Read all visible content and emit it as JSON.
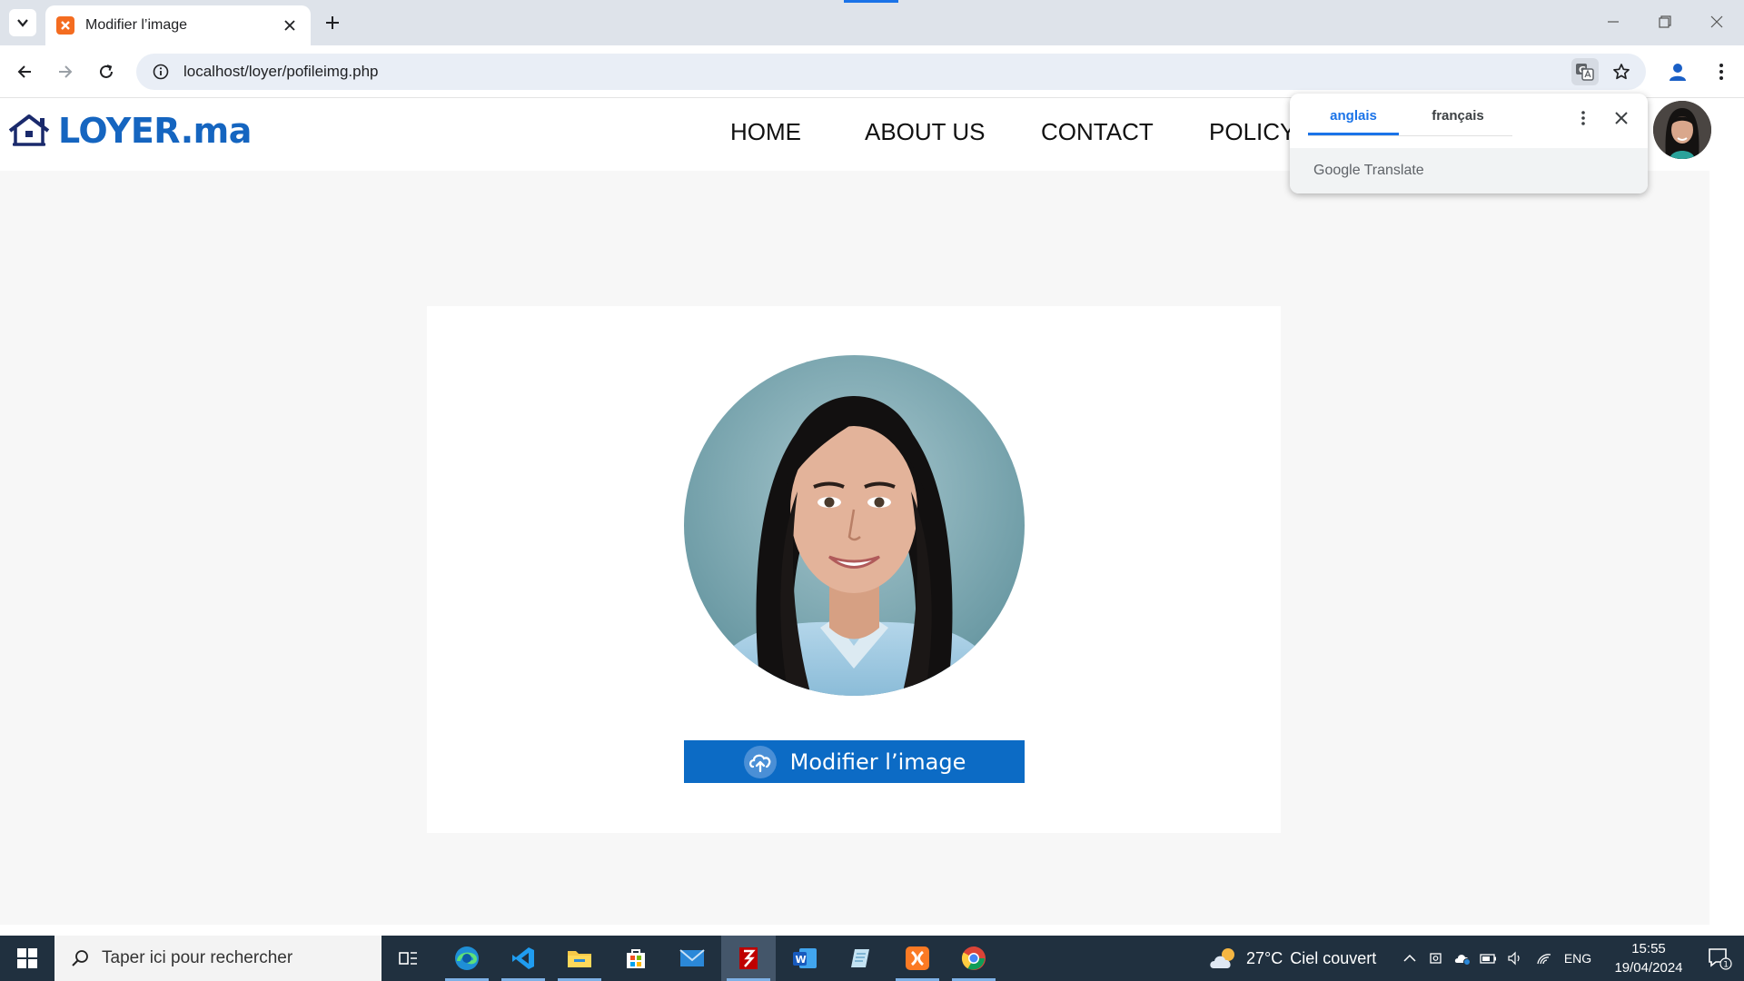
{
  "browser": {
    "tab_title": "Modifier l’image",
    "url": "localhost/loyer/pofileimg.php"
  },
  "site": {
    "logo_text": "LOYER.ma",
    "nav": [
      "HOME",
      "ABOUT US",
      "CONTACT",
      "POLICY"
    ]
  },
  "profile": {
    "upload_button_label": "Modifier l’image"
  },
  "translate_popup": {
    "tabs": [
      "anglais",
      "français"
    ],
    "active_tab": "anglais",
    "footer_brand": "Google",
    "footer_product": "Translate"
  },
  "taskbar": {
    "search_placeholder": "Taper ici pour rechercher",
    "weather_temp": "27°C",
    "weather_desc": "Ciel couvert",
    "language": "ENG",
    "time": "15:55",
    "date": "19/04/2024",
    "notification_count": "1",
    "apps": [
      "task-view",
      "edge",
      "vscode",
      "file-explorer",
      "microsoft-store",
      "mail",
      "filezilla",
      "word",
      "notepad",
      "xampp",
      "chrome"
    ]
  },
  "colors": {
    "brand_blue": "#1565c0",
    "button_blue": "#0c6bc5",
    "accent": "#1a73e8",
    "taskbar": "#20303f"
  }
}
